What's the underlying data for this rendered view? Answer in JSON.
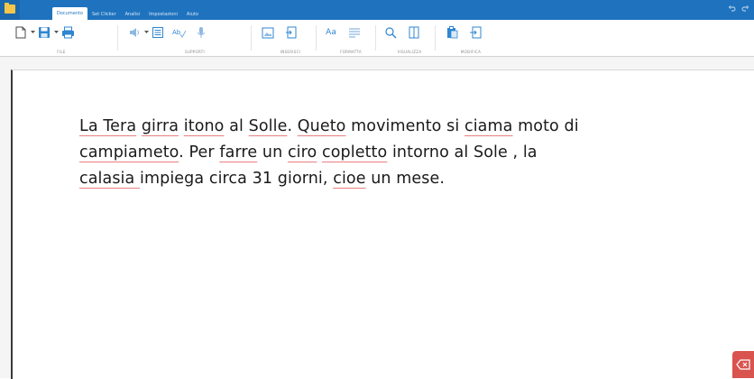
{
  "tabs": [
    {
      "label": "Documento",
      "active": true
    },
    {
      "label": "Set Clicker",
      "active": false
    },
    {
      "label": "Analisi",
      "active": false
    },
    {
      "label": "Impostazioni",
      "active": false
    },
    {
      "label": "Aiuto",
      "active": false
    }
  ],
  "ribbon": {
    "groups": {
      "file": "FILE",
      "supporti": "SUPPORTI",
      "inserisci": "INSERISCI",
      "formatta": "FORMATTA",
      "visualizza": "VISUALIZZA",
      "modifica": "MODIFICA"
    },
    "format_icon_text": "Aa"
  },
  "document": {
    "lines": [
      [
        {
          "t": "La Tera",
          "err": true
        },
        {
          "t": " "
        },
        {
          "t": "girra",
          "err": true
        },
        {
          "t": " "
        },
        {
          "t": "itono",
          "err": true
        },
        {
          "t": " al "
        },
        {
          "t": "Solle",
          "err": true
        },
        {
          "t": ". "
        },
        {
          "t": "Queto",
          "err": true
        },
        {
          "t": " movimento si "
        },
        {
          "t": "ciama",
          "err": true
        },
        {
          "t": " moto di"
        }
      ],
      [
        {
          "t": "campiameto",
          "err": true
        },
        {
          "t": ". Per "
        },
        {
          "t": "farre",
          "err": true
        },
        {
          "t": " un "
        },
        {
          "t": "ciro",
          "err": true
        },
        {
          "t": " "
        },
        {
          "t": "copletto",
          "err": true
        },
        {
          "t": " intorno al Sole , la"
        }
      ],
      [
        {
          "t": "calasia ",
          "err": true
        },
        {
          "t": " impiega circa 31 giorni, "
        },
        {
          "t": "cioe",
          "err": true
        },
        {
          "t": " un mese."
        }
      ]
    ]
  },
  "colors": {
    "titlebar": "#1f73be",
    "icon_blue": "#2f86d1",
    "underline_error": "#e88080",
    "delete_button": "#d9534f"
  },
  "icons": {
    "undo": "undo-icon",
    "redo": "redo-icon",
    "delete": "backspace-icon"
  }
}
